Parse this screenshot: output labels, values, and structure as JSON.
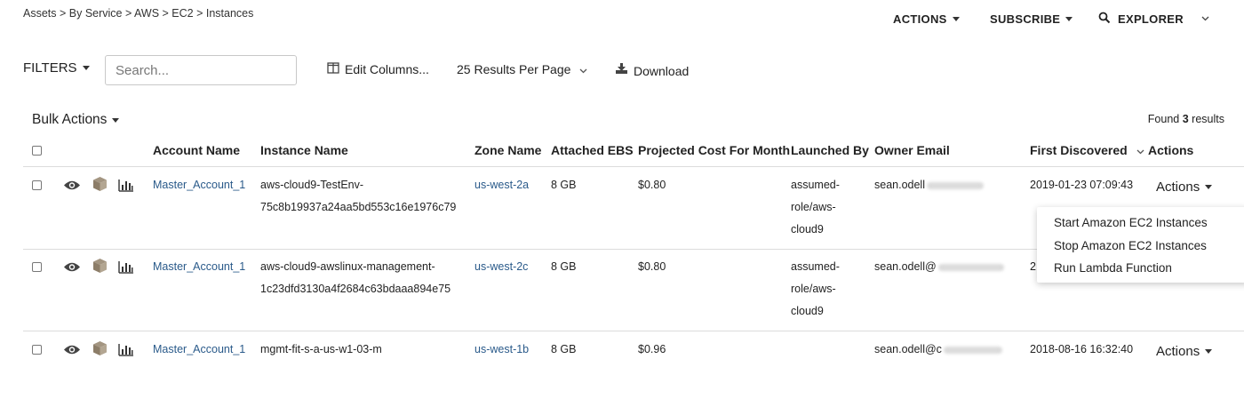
{
  "breadcrumb": "Assets > By Service > AWS > EC2 > Instances",
  "topnav": {
    "actions": "ACTIONS",
    "subscribe": "SUBSCRIBE",
    "explorer": "EXPLORER"
  },
  "toolbar": {
    "filters": "FILTERS",
    "search_placeholder": "Search...",
    "edit_columns": "Edit Columns...",
    "results_per_page": "25 Results Per Page",
    "download": "Download"
  },
  "bulk_actions": "Bulk Actions",
  "found": {
    "prefix": "Found",
    "count": "3",
    "suffix": "results"
  },
  "columns": [
    "Account Name",
    "Instance Name",
    "Zone Name",
    "Attached EBS",
    "Projected Cost For Month",
    "Launched By",
    "Owner Email",
    "First Discovered",
    "Actions"
  ],
  "rows": [
    {
      "account": "Master_Account_1",
      "instance_l1": "aws-cloud9-TestEnv-",
      "instance_l2": "75c8b19937a24aa5bd553c16e1976c79",
      "zone": "us-west-2a",
      "ebs": "8 GB",
      "cost": "$0.80",
      "launched_l1": "assumed-",
      "launched_l2": "role/aws-",
      "launched_l3": "cloud9",
      "email": "sean.odell",
      "first": "2019-01-23 07:09:43",
      "actions": "Actions"
    },
    {
      "account": "Master_Account_1",
      "instance_l1": "aws-cloud9-awslinux-management-",
      "instance_l2": "1c23dfd3130a4f2684c63bdaaa894e75",
      "zone": "us-west-2c",
      "ebs": "8 GB",
      "cost": "$0.80",
      "launched_l1": "assumed-",
      "launched_l2": "role/aws-",
      "launched_l3": "cloud9",
      "email": "sean.odell@",
      "first": "2",
      "actions": "Actions"
    },
    {
      "account": "Master_Account_1",
      "instance_l1": "mgmt-fit-s-a-us-w1-03-m",
      "instance_l2": "",
      "zone": "us-west-1b",
      "ebs": "8 GB",
      "cost": "$0.96",
      "launched_l1": "",
      "launched_l2": "",
      "launched_l3": "",
      "email": "sean.odell@c",
      "first": "2018-08-16 16:32:40",
      "actions": "Actions"
    }
  ],
  "dropdown_menu": [
    "Start Amazon EC2 Instances",
    "Stop Amazon EC2 Instances",
    "Run Lambda Function"
  ],
  "colors": {
    "link": "#2a5a8a",
    "divider": "#dcdcdc"
  },
  "icons": {
    "row": [
      "eye-icon",
      "cube-icon",
      "bar-chart-icon"
    ],
    "edit_columns": "columns-icon",
    "download": "download-icon",
    "explorer": "search-icon"
  }
}
